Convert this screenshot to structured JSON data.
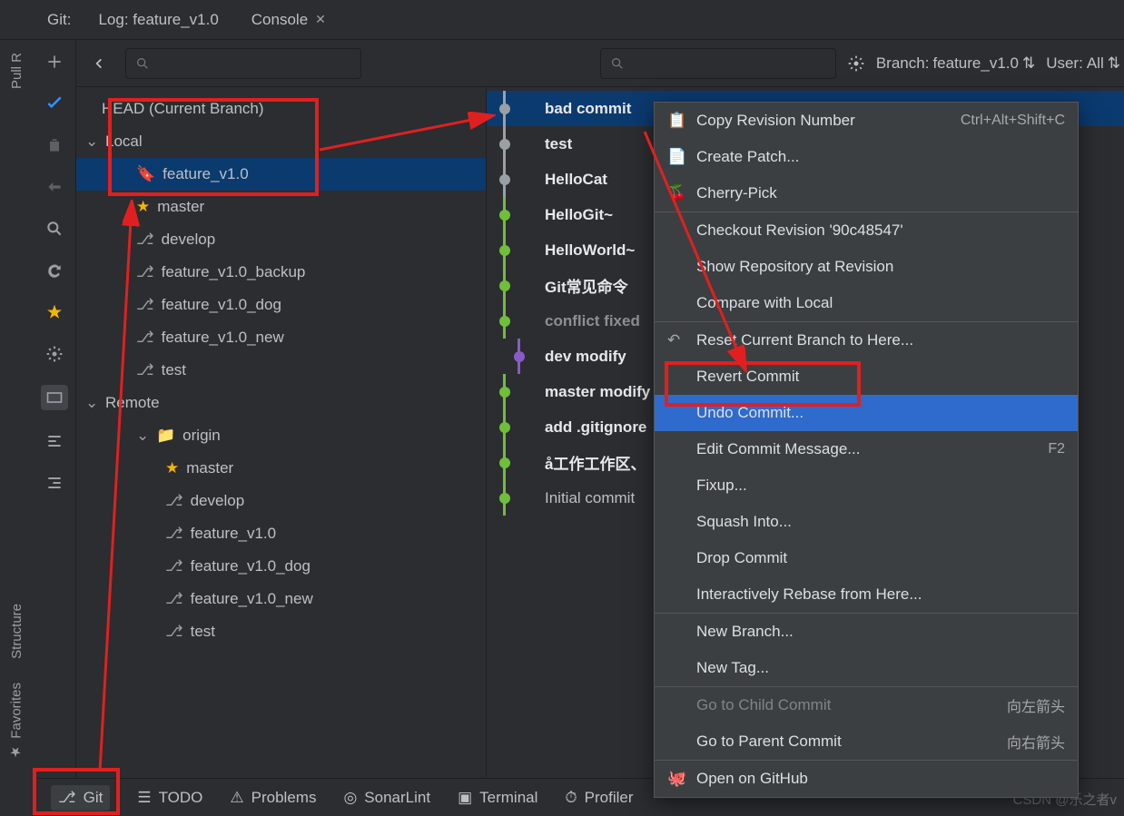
{
  "tabs": {
    "git_label": "Git:",
    "log_tab": "Log: feature_v1.0",
    "console_tab": "Console"
  },
  "subbar": {
    "branch_label": "Branch:",
    "branch_value": "feature_v1.0",
    "user_label": "User:",
    "user_value": "All"
  },
  "tree": {
    "head": "HEAD (Current Branch)",
    "local": "Local",
    "remote": "Remote",
    "local_items": [
      "feature_v1.0",
      "master",
      "develop",
      "feature_v1.0_backup",
      "feature_v1.0_dog",
      "feature_v1.0_new",
      "test"
    ],
    "origin": "origin",
    "remote_items": [
      "master",
      "develop",
      "feature_v1.0",
      "feature_v1.0_dog",
      "feature_v1.0_new",
      "test"
    ]
  },
  "commits": [
    {
      "msg": "bad commit",
      "bold": true,
      "sel": true,
      "col": "#9aa0a6",
      "x": 0
    },
    {
      "msg": "test",
      "bold": true,
      "col": "#9aa0a6",
      "x": 0
    },
    {
      "msg": "HelloCat",
      "bold": true,
      "col": "#9aa0a6",
      "x": 0
    },
    {
      "msg": "HelloGit~",
      "bold": true,
      "col": "#6fbf3a",
      "x": 0
    },
    {
      "msg": "HelloWorld~",
      "bold": true,
      "col": "#6fbf3a",
      "x": 0
    },
    {
      "msg": "Git常见命令",
      "bold": true,
      "col": "#6fbf3a",
      "x": 0
    },
    {
      "msg": "conflict fixed",
      "bold": true,
      "dim": true,
      "col": "#6fbf3a",
      "x": 0
    },
    {
      "msg": "dev modify",
      "bold": true,
      "col": "#8a5bc4",
      "x": 1
    },
    {
      "msg": "master modify",
      "bold": true,
      "col": "#6fbf3a",
      "x": 0
    },
    {
      "msg": "add .gitignore",
      "bold": true,
      "col": "#6fbf3a",
      "x": 0
    },
    {
      "msg": "å工作工作区、",
      "bold": true,
      "col": "#6fbf3a",
      "x": 0
    },
    {
      "msg": "Initial commit",
      "bold": false,
      "col": "#6fbf3a",
      "x": 0
    }
  ],
  "ctx": {
    "copy": "Copy Revision Number",
    "copy_sc": "Ctrl+Alt+Shift+C",
    "patch": "Create Patch...",
    "cherry": "Cherry-Pick",
    "checkout": "Checkout Revision '90c48547'",
    "showrepo": "Show Repository at Revision",
    "compare": "Compare with Local",
    "reset": "Reset Current Branch to Here...",
    "revert": "Revert Commit",
    "undo": "Undo Commit...",
    "editmsg": "Edit Commit Message...",
    "editmsg_sc": "F2",
    "fixup": "Fixup...",
    "squash": "Squash Into...",
    "drop": "Drop Commit",
    "rebase": "Interactively Rebase from Here...",
    "newbranch": "New Branch...",
    "newtag": "New Tag...",
    "child": "Go to Child Commit",
    "child_sc": "向左箭头",
    "parent": "Go to Parent Commit",
    "parent_sc": "向右箭头",
    "github": "Open on GitHub"
  },
  "bottom": {
    "git": "Git",
    "todo": "TODO",
    "problems": "Problems",
    "sonar": "SonarLint",
    "terminal": "Terminal",
    "profiler": "Profiler"
  },
  "sidebar": {
    "pull": "Pull R",
    "structure": "Structure",
    "favorites": "Favorites"
  },
  "watermark": "CSDN @乐之者v"
}
